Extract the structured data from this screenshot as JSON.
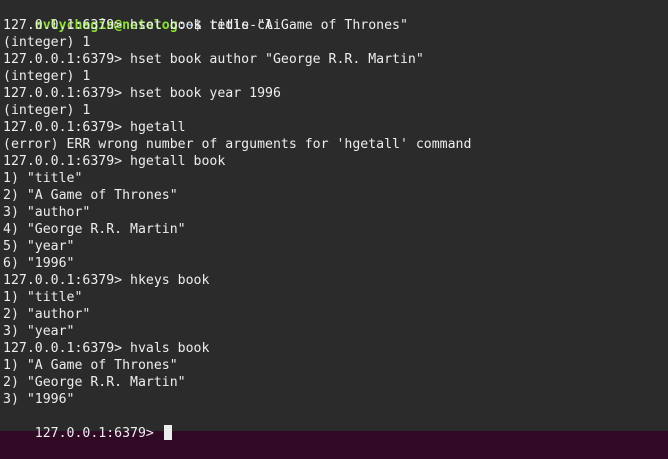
{
  "theme": {
    "background": "#2b2b2b",
    "foreground": "#ededed",
    "user_color": "#8ae234",
    "path_color": "#729fcf"
  },
  "shell": {
    "user_host": "nvlychagin@netolog",
    "sep": ":",
    "path": "~",
    "symbol": "$ ",
    "command": "redis-cli"
  },
  "lines": [
    "127.0.0.1:6379> hset book title \"A Game of Thrones\"",
    "(integer) 1",
    "127.0.0.1:6379> hset book author \"George R.R. Martin\"",
    "(integer) 1",
    "127.0.0.1:6379> hset book year 1996",
    "(integer) 1",
    "127.0.0.1:6379> hgetall",
    "(error) ERR wrong number of arguments for 'hgetall' command",
    "127.0.0.1:6379> hgetall book",
    "1) \"title\"",
    "2) \"A Game of Thrones\"",
    "3) \"author\"",
    "4) \"George R.R. Martin\"",
    "5) \"year\"",
    "6) \"1996\"",
    "127.0.0.1:6379> hkeys book",
    "1) \"title\"",
    "2) \"author\"",
    "3) \"year\"",
    "127.0.0.1:6379> hvals book",
    "1) \"A Game of Thrones\"",
    "2) \"George R.R. Martin\"",
    "3) \"1996\""
  ],
  "prompt": "127.0.0.1:6379> "
}
